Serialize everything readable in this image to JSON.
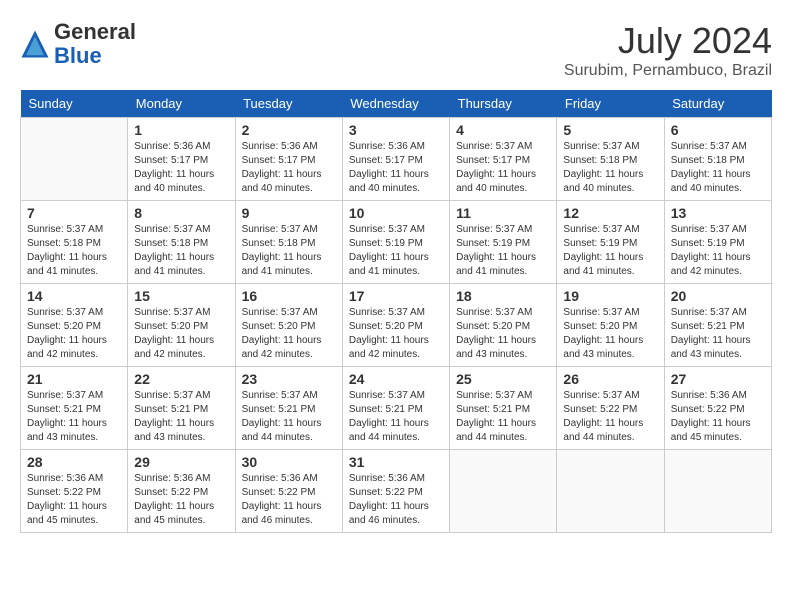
{
  "header": {
    "logo_general": "General",
    "logo_blue": "Blue",
    "title": "July 2024",
    "location": "Surubim, Pernambuco, Brazil"
  },
  "weekdays": [
    "Sunday",
    "Monday",
    "Tuesday",
    "Wednesday",
    "Thursday",
    "Friday",
    "Saturday"
  ],
  "weeks": [
    [
      {
        "day": "",
        "sunrise": "",
        "sunset": "",
        "daylight": ""
      },
      {
        "day": "1",
        "sunrise": "Sunrise: 5:36 AM",
        "sunset": "Sunset: 5:17 PM",
        "daylight": "Daylight: 11 hours and 40 minutes."
      },
      {
        "day": "2",
        "sunrise": "Sunrise: 5:36 AM",
        "sunset": "Sunset: 5:17 PM",
        "daylight": "Daylight: 11 hours and 40 minutes."
      },
      {
        "day": "3",
        "sunrise": "Sunrise: 5:36 AM",
        "sunset": "Sunset: 5:17 PM",
        "daylight": "Daylight: 11 hours and 40 minutes."
      },
      {
        "day": "4",
        "sunrise": "Sunrise: 5:37 AM",
        "sunset": "Sunset: 5:17 PM",
        "daylight": "Daylight: 11 hours and 40 minutes."
      },
      {
        "day": "5",
        "sunrise": "Sunrise: 5:37 AM",
        "sunset": "Sunset: 5:18 PM",
        "daylight": "Daylight: 11 hours and 40 minutes."
      },
      {
        "day": "6",
        "sunrise": "Sunrise: 5:37 AM",
        "sunset": "Sunset: 5:18 PM",
        "daylight": "Daylight: 11 hours and 40 minutes."
      }
    ],
    [
      {
        "day": "7",
        "sunrise": "Sunrise: 5:37 AM",
        "sunset": "Sunset: 5:18 PM",
        "daylight": "Daylight: 11 hours and 41 minutes."
      },
      {
        "day": "8",
        "sunrise": "Sunrise: 5:37 AM",
        "sunset": "Sunset: 5:18 PM",
        "daylight": "Daylight: 11 hours and 41 minutes."
      },
      {
        "day": "9",
        "sunrise": "Sunrise: 5:37 AM",
        "sunset": "Sunset: 5:18 PM",
        "daylight": "Daylight: 11 hours and 41 minutes."
      },
      {
        "day": "10",
        "sunrise": "Sunrise: 5:37 AM",
        "sunset": "Sunset: 5:19 PM",
        "daylight": "Daylight: 11 hours and 41 minutes."
      },
      {
        "day": "11",
        "sunrise": "Sunrise: 5:37 AM",
        "sunset": "Sunset: 5:19 PM",
        "daylight": "Daylight: 11 hours and 41 minutes."
      },
      {
        "day": "12",
        "sunrise": "Sunrise: 5:37 AM",
        "sunset": "Sunset: 5:19 PM",
        "daylight": "Daylight: 11 hours and 41 minutes."
      },
      {
        "day": "13",
        "sunrise": "Sunrise: 5:37 AM",
        "sunset": "Sunset: 5:19 PM",
        "daylight": "Daylight: 11 hours and 42 minutes."
      }
    ],
    [
      {
        "day": "14",
        "sunrise": "Sunrise: 5:37 AM",
        "sunset": "Sunset: 5:20 PM",
        "daylight": "Daylight: 11 hours and 42 minutes."
      },
      {
        "day": "15",
        "sunrise": "Sunrise: 5:37 AM",
        "sunset": "Sunset: 5:20 PM",
        "daylight": "Daylight: 11 hours and 42 minutes."
      },
      {
        "day": "16",
        "sunrise": "Sunrise: 5:37 AM",
        "sunset": "Sunset: 5:20 PM",
        "daylight": "Daylight: 11 hours and 42 minutes."
      },
      {
        "day": "17",
        "sunrise": "Sunrise: 5:37 AM",
        "sunset": "Sunset: 5:20 PM",
        "daylight": "Daylight: 11 hours and 42 minutes."
      },
      {
        "day": "18",
        "sunrise": "Sunrise: 5:37 AM",
        "sunset": "Sunset: 5:20 PM",
        "daylight": "Daylight: 11 hours and 43 minutes."
      },
      {
        "day": "19",
        "sunrise": "Sunrise: 5:37 AM",
        "sunset": "Sunset: 5:20 PM",
        "daylight": "Daylight: 11 hours and 43 minutes."
      },
      {
        "day": "20",
        "sunrise": "Sunrise: 5:37 AM",
        "sunset": "Sunset: 5:21 PM",
        "daylight": "Daylight: 11 hours and 43 minutes."
      }
    ],
    [
      {
        "day": "21",
        "sunrise": "Sunrise: 5:37 AM",
        "sunset": "Sunset: 5:21 PM",
        "daylight": "Daylight: 11 hours and 43 minutes."
      },
      {
        "day": "22",
        "sunrise": "Sunrise: 5:37 AM",
        "sunset": "Sunset: 5:21 PM",
        "daylight": "Daylight: 11 hours and 43 minutes."
      },
      {
        "day": "23",
        "sunrise": "Sunrise: 5:37 AM",
        "sunset": "Sunset: 5:21 PM",
        "daylight": "Daylight: 11 hours and 44 minutes."
      },
      {
        "day": "24",
        "sunrise": "Sunrise: 5:37 AM",
        "sunset": "Sunset: 5:21 PM",
        "daylight": "Daylight: 11 hours and 44 minutes."
      },
      {
        "day": "25",
        "sunrise": "Sunrise: 5:37 AM",
        "sunset": "Sunset: 5:21 PM",
        "daylight": "Daylight: 11 hours and 44 minutes."
      },
      {
        "day": "26",
        "sunrise": "Sunrise: 5:37 AM",
        "sunset": "Sunset: 5:22 PM",
        "daylight": "Daylight: 11 hours and 44 minutes."
      },
      {
        "day": "27",
        "sunrise": "Sunrise: 5:36 AM",
        "sunset": "Sunset: 5:22 PM",
        "daylight": "Daylight: 11 hours and 45 minutes."
      }
    ],
    [
      {
        "day": "28",
        "sunrise": "Sunrise: 5:36 AM",
        "sunset": "Sunset: 5:22 PM",
        "daylight": "Daylight: 11 hours and 45 minutes."
      },
      {
        "day": "29",
        "sunrise": "Sunrise: 5:36 AM",
        "sunset": "Sunset: 5:22 PM",
        "daylight": "Daylight: 11 hours and 45 minutes."
      },
      {
        "day": "30",
        "sunrise": "Sunrise: 5:36 AM",
        "sunset": "Sunset: 5:22 PM",
        "daylight": "Daylight: 11 hours and 46 minutes."
      },
      {
        "day": "31",
        "sunrise": "Sunrise: 5:36 AM",
        "sunset": "Sunset: 5:22 PM",
        "daylight": "Daylight: 11 hours and 46 minutes."
      },
      {
        "day": "",
        "sunrise": "",
        "sunset": "",
        "daylight": ""
      },
      {
        "day": "",
        "sunrise": "",
        "sunset": "",
        "daylight": ""
      },
      {
        "day": "",
        "sunrise": "",
        "sunset": "",
        "daylight": ""
      }
    ]
  ]
}
